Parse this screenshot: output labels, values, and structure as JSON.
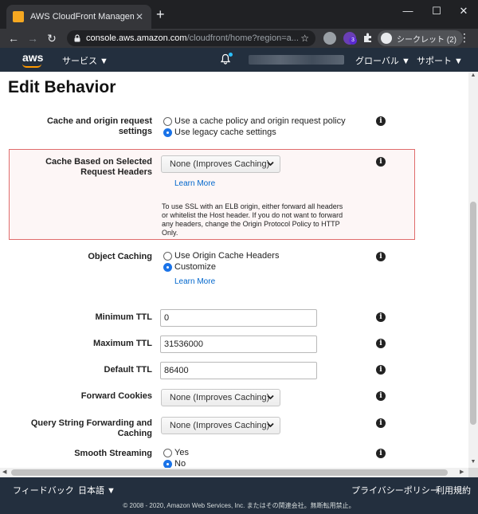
{
  "browser": {
    "tab_title": "AWS CloudFront Management Co",
    "tab_close": "✕",
    "new_tab": "+",
    "minimize": "—",
    "maximize": "☐",
    "close": "✕",
    "back": "←",
    "forward": "→",
    "reload": "↻",
    "url_host": "console.aws.amazon.com",
    "url_path": "/cloudfront/home?region=a...",
    "star": "☆",
    "incognito_label": "シークレット (2)",
    "menu": "⋮",
    "extension_badge": "3"
  },
  "aws_nav": {
    "logo": "aws",
    "services": "サービス ▼",
    "region": "グローバル ▼",
    "support": "サポート ▼"
  },
  "page": {
    "title": "Edit Behavior",
    "info_glyph": "i",
    "cache_policy": {
      "label_line1": "Cache and origin request",
      "label_line2": "settings",
      "option1": "Use a cache policy and origin request policy",
      "option2": "Use legacy cache settings"
    },
    "cache_headers": {
      "label_line1": "Cache Based on Selected",
      "label_line2": "Request Headers",
      "value": "None (Improves Caching)",
      "learn_more": "Learn More",
      "note": "To use SSL with an ELB origin, either forward all headers or whitelist the Host header. If you do not want to forward any headers, change the Origin Protocol Policy to HTTP Only."
    },
    "object_caching": {
      "label": "Object Caching",
      "option1": "Use Origin Cache Headers",
      "option2": "Customize",
      "learn_more": "Learn More"
    },
    "min_ttl": {
      "label": "Minimum TTL",
      "value": "0"
    },
    "max_ttl": {
      "label": "Maximum TTL",
      "value": "31536000"
    },
    "default_ttl": {
      "label": "Default TTL",
      "value": "86400"
    },
    "forward_cookies": {
      "label": "Forward Cookies",
      "value": "None (Improves Caching)"
    },
    "query_string": {
      "label_line1": "Query String Forwarding and",
      "label_line2": "Caching",
      "value": "None (Improves Caching)"
    },
    "smooth_streaming": {
      "label": "Smooth Streaming",
      "option1": "Yes",
      "option2": "No"
    }
  },
  "footer": {
    "feedback": "フィードバック",
    "language": "日本語 ▼",
    "privacy": "プライバシーポリシー",
    "terms": "利用規約",
    "copyright": "© 2008 - 2020, Amazon Web Services, Inc. またはその関連会社。無断転用禁止。"
  },
  "colors": {
    "aws_nav_bg": "#232f3e",
    "error_border": "#e06c6c",
    "link": "#0066cc",
    "radio_selected": "#1a73e8"
  }
}
